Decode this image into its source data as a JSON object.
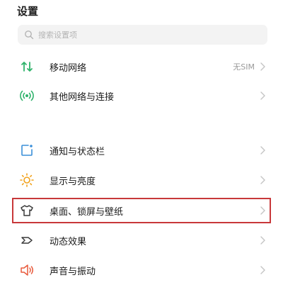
{
  "header": {
    "title": "设置"
  },
  "search": {
    "placeholder": "搜索设置项"
  },
  "menu": {
    "items": [
      {
        "label": "移动网络",
        "value": "无SIM",
        "icon": "mobile-data-icon"
      },
      {
        "label": "其他网络与连接",
        "value": "",
        "icon": "wireless-signal-icon"
      },
      {
        "label": "通知与状态栏",
        "value": "",
        "icon": "notification-icon"
      },
      {
        "label": "显示与亮度",
        "value": "",
        "icon": "brightness-icon"
      },
      {
        "label": "桌面、锁屏与壁纸",
        "value": "",
        "icon": "tshirt-icon"
      },
      {
        "label": "动态效果",
        "value": "",
        "icon": "dynamic-effect-icon"
      },
      {
        "label": "声音与振动",
        "value": "",
        "icon": "speaker-icon"
      }
    ]
  },
  "colors": {
    "highlight": "#c8383a",
    "icon_green": "#2fb36b",
    "icon_blue": "#3a8fd9",
    "icon_yellow": "#f1a21c",
    "icon_red": "#e85a3c"
  }
}
